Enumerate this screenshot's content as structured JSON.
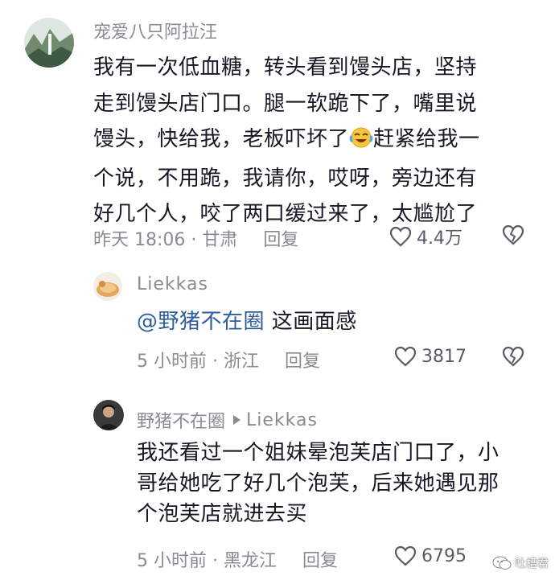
{
  "comment": {
    "username": "宠爱八只阿拉汪",
    "lines": [
      "我有一次低血糖，转头看到馒头店，坚持",
      "走到馒头店门口。腿一软跪下了，嘴里说",
      "馒头，快给我，老板吓坏了",
      "赶紧给我一",
      "个说，不用跪，我请你，哎呀，旁边还有",
      "好几个人，咬了两口缓过来了，太尴尬了"
    ],
    "emoji": "rofl-emoji",
    "time": "昨天 18:06 · 甘肃",
    "reply_label": "回复",
    "likes": "4.4万"
  },
  "reply1": {
    "username": "Liekkas",
    "mention": "@野猪不在圈",
    "text": " 这画面感",
    "time": "5 小时前 · 浙江",
    "reply_label": "回复",
    "likes": "3817"
  },
  "reply2": {
    "username": "野猪不在圈",
    "reply_to": "Liekkas",
    "lines": [
      "我还看过一个姐妹晕泡芙店门口了，小",
      "哥给她吃了好几个泡芙，后来她遇见那",
      "个泡芙店就进去买"
    ],
    "time": "5 小时前 · 黑龙江",
    "reply_label": "回复",
    "likes": "6795"
  },
  "watermark": {
    "text": "吐槽君"
  },
  "colors": {
    "text": "#161823",
    "meta": "#8a8b91",
    "mention": "#2f5d9b"
  }
}
